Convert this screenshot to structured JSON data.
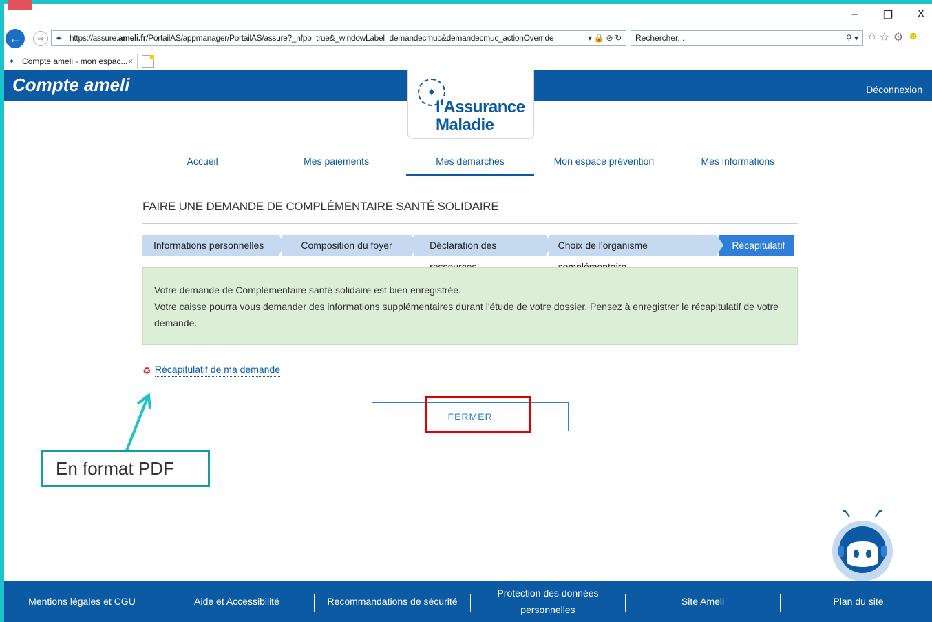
{
  "browser": {
    "url_prefix": "https://assure.",
    "url_domain": "ameli.fr",
    "url_rest": "/PortailAS/appmanager/PortailAS/assure?_nfpb=true&_windowLabel=demandecmuc&demandecmuc_actionOverride",
    "search_placeholder": "Rechercher...",
    "tab_title": "Compte ameli - mon espac...",
    "controls": {
      "minimize": "–",
      "restore": "❐",
      "close": "X"
    }
  },
  "site": {
    "title": "Compte ameli",
    "logout": "Déconnexion",
    "logo_line1": "l'Assurance",
    "logo_line2": "Maladie"
  },
  "nav": {
    "items": [
      {
        "label": "Accueil"
      },
      {
        "label": "Mes paiements"
      },
      {
        "label": "Mes démarches"
      },
      {
        "label": "Mon espace prévention"
      },
      {
        "label": "Mes informations"
      }
    ]
  },
  "page": {
    "title": "FAIRE UNE DEMANDE DE COMPLÉMENTAIRE SANTÉ SOLIDAIRE",
    "steps": [
      {
        "label": "Informations personnelles"
      },
      {
        "label": "Composition du foyer"
      },
      {
        "label": "Déclaration des ressources"
      },
      {
        "label": "Choix de l'organisme complémentaire"
      },
      {
        "label": "Récapitulatif"
      }
    ],
    "alert_line1": "Votre demande de Complémentaire santé solidaire est bien enregistrée.",
    "alert_line2": "Votre caisse pourra vous demander des informations supplémentaires durant l'étude de votre dossier. Pensez à enregistrer le récapitulatif de votre demande.",
    "pdf_link": "Récapitulatif de ma demande",
    "close_button": "FERMER"
  },
  "annotation": {
    "text": "En format PDF"
  },
  "footer": {
    "links": [
      {
        "label": "Mentions légales et CGU"
      },
      {
        "label": "Aide et Accessibilité"
      },
      {
        "label": "Recommandations de sécurité"
      },
      {
        "label": "Protection des données personnelles"
      },
      {
        "label": "Site Ameli"
      },
      {
        "label": "Plan du site"
      }
    ]
  },
  "colors": {
    "brand_blue": "#0b5aa3",
    "step_inactive": "#c5daf0",
    "step_active": "#2f7ed8",
    "alert_bg": "#ddeed7",
    "frame_teal": "#1ec3c9",
    "highlight_red": "#e00000"
  }
}
